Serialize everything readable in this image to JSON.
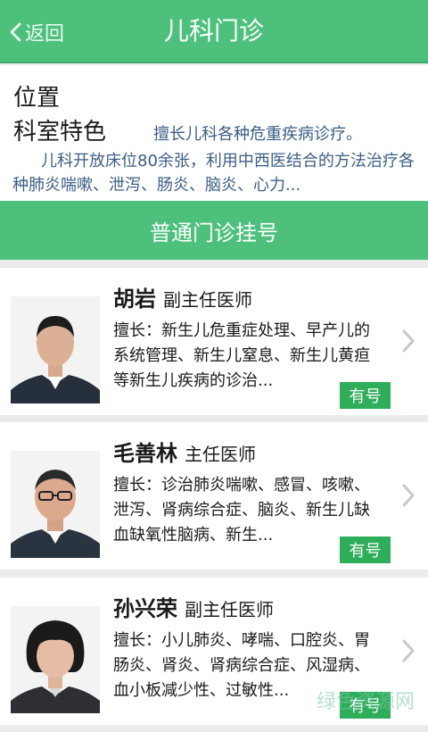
{
  "header": {
    "back_label": "返回",
    "title": "儿科门诊"
  },
  "info": {
    "location_label": "位置",
    "department_label": "科室特色",
    "department_summary": "擅长儿科各种危重疾病诊疗。",
    "department_detail": "儿科开放床位80余张，利用中西医结合的方法治疗各种肺炎喘嗽、泄泻、肠炎、脑炎、心力..."
  },
  "register_button": "普通门诊挂号",
  "doctors": [
    {
      "name": "胡岩",
      "rank": "副主任医师",
      "specialty": "擅长：新生儿危重症处理、早产儿的系统管理、新生儿窒息、新生儿黄疸等新生儿疾病的诊治...",
      "availability": "有号"
    },
    {
      "name": "毛善林",
      "rank": "主任医师",
      "specialty": "擅长：诊治肺炎喘嗽、感冒、咳嗽、泄泻、肾病综合症、脑炎、新生儿缺血缺氧性脑病、新生...",
      "availability": "有号"
    },
    {
      "name": "孙兴荣",
      "rank": "副主任医师",
      "specialty": "擅长：小儿肺炎、哮喘、口腔炎、胃肠炎、肾炎、肾病综合症、风湿病、血小板减少性、过敏性...",
      "availability": "有号"
    }
  ],
  "watermark": "绿色资源网",
  "colors": {
    "primary_green": "#4dc17c",
    "badge_green": "#2fae5a",
    "desc_blue": "#3a5e86",
    "background": "#ebebeb"
  },
  "icons": {
    "back": "chevron-left-icon",
    "card_arrow": "chevron-right-icon"
  }
}
